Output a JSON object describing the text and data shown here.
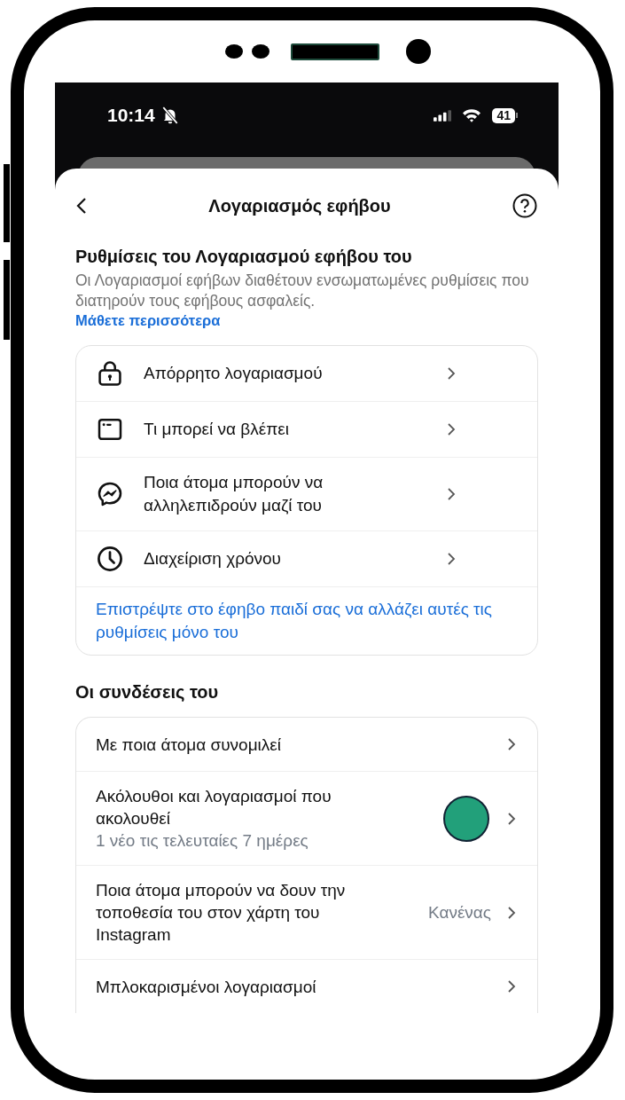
{
  "status_bar": {
    "time": "10:14",
    "silent": true,
    "battery": "41"
  },
  "header": {
    "title": "Λογαριασμός εφήβου"
  },
  "intro": {
    "title": "Ρυθμίσεις του Λογαριασμού εφήβου του",
    "description": "Οι Λογαριασμοί εφήβων διαθέτουν ενσωματωμένες ρυθμίσεις που διατηρούν τους εφήβους ασφαλείς.",
    "link": "Μάθετε περισσότερα"
  },
  "settings": {
    "items": [
      {
        "label": "Απόρρητο λογαριασμού"
      },
      {
        "label": "Τι μπορεί να βλέπει"
      },
      {
        "label": "Ποια άτομα μπορούν να αλληλεπιδρούν μαζί του"
      },
      {
        "label": "Διαχείριση χρόνου"
      }
    ],
    "footer_link": "Επιστρέψτε στο έφηβο παιδί σας να αλλάζει αυτές τις ρυθμίσεις μόνο του"
  },
  "connections": {
    "title": "Οι συνδέσεις του",
    "items": [
      {
        "label": "Με ποια άτομα συνομιλεί",
        "avatar": false
      },
      {
        "label": "Ακόλουθοι και λογαριασμοί που ακολουθεί",
        "subtitle": "1 νέο τις τελευταίες 7 ημέρες",
        "avatar": true
      },
      {
        "label": "Ποια άτομα μπορούν να δουν την τοποθεσία του στον χάρτη του Instagram",
        "value": "Κανένας",
        "avatar": false
      },
      {
        "label": "Μπλοκαρισμένοι λογαριασμοί",
        "avatar": false
      }
    ]
  }
}
